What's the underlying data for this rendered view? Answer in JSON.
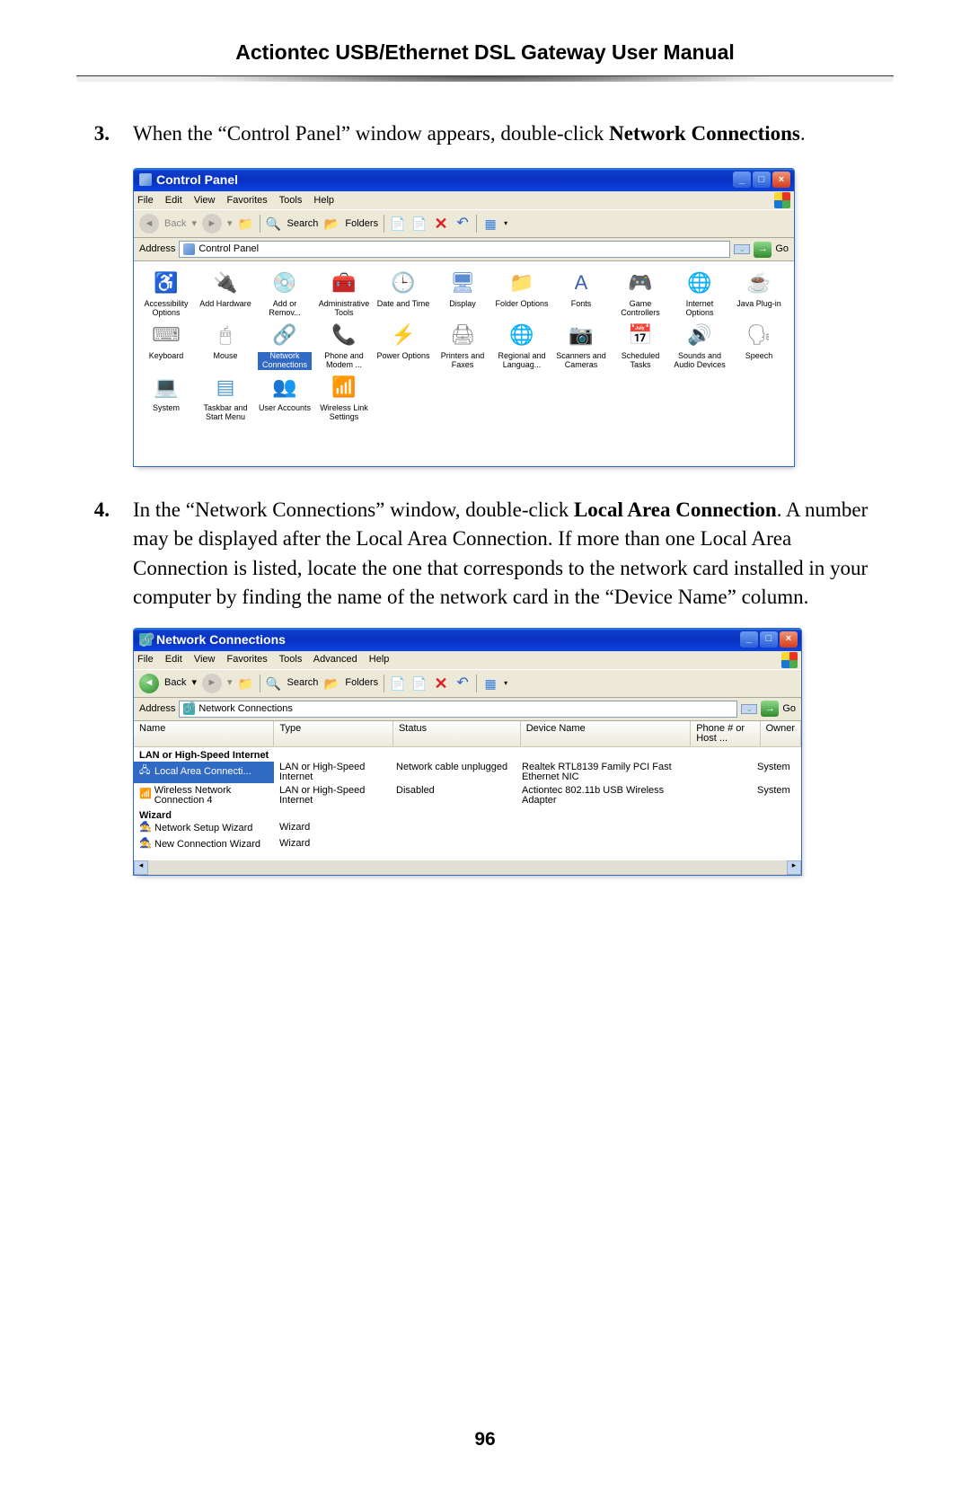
{
  "header": {
    "title": "Actiontec USB/Ethernet DSL Gateway User Manual"
  },
  "page_number": "96",
  "steps": [
    {
      "num": "3.",
      "pre": "When the “Control Panel” window appears, double-click",
      "bold": "Network Connections",
      "post": "."
    },
    {
      "num": "4.",
      "pre": "In the “Network Connections” window, double-click",
      "bold": "Local Area Connection",
      "post": ". A number may be displayed after the Local Area Connection. If more than one Local Area Connection is listed, locate the one that corresponds to the network card installed in your computer by finding the name of the network card in the “Device Name” column."
    }
  ],
  "cp": {
    "title": "Control Panel",
    "menu": [
      "File",
      "Edit",
      "View",
      "Favorites",
      "Tools",
      "Help"
    ],
    "back_label": "Back",
    "search_label": "Search",
    "folders_label": "Folders",
    "address_label": "Address",
    "address_value": "Control Panel",
    "go_label": "Go",
    "items": [
      {
        "glyph": "♿",
        "color": "#3a9a3a",
        "label": "Accessibility Options"
      },
      {
        "glyph": "🔌",
        "color": "#777",
        "label": "Add Hardware"
      },
      {
        "glyph": "💿",
        "color": "#5b8bd0",
        "label": "Add or Remov..."
      },
      {
        "glyph": "🧰",
        "color": "#b96a36",
        "label": "Administrative Tools"
      },
      {
        "glyph": "🕒",
        "color": "#5b8bd0",
        "label": "Date and Time"
      },
      {
        "glyph": "🖥",
        "color": "#5b8bd0",
        "label": "Display"
      },
      {
        "glyph": "📁",
        "color": "#e8c252",
        "label": "Folder Options"
      },
      {
        "glyph": "A",
        "color": "#3a5fb0",
        "label": "Fonts"
      },
      {
        "glyph": "🎮",
        "color": "#4a95c8",
        "label": "Game Controllers"
      },
      {
        "glyph": "🌐",
        "color": "#5b8bd0",
        "label": "Internet Options"
      },
      {
        "glyph": "☕",
        "color": "#b0302a",
        "label": "Java Plug-in"
      },
      {
        "glyph": "⌨",
        "color": "#888",
        "label": "Keyboard"
      },
      {
        "glyph": "🖱",
        "color": "#888",
        "label": "Mouse"
      },
      {
        "glyph": "🔗",
        "color": "#2a62c5",
        "label": "Network Connections",
        "selected": true
      },
      {
        "glyph": "📞",
        "color": "#e8c252",
        "label": "Phone and Modem ..."
      },
      {
        "glyph": "⚡",
        "color": "#5b8bd0",
        "label": "Power Options"
      },
      {
        "glyph": "🖨",
        "color": "#888",
        "label": "Printers and Faxes"
      },
      {
        "glyph": "🌐",
        "color": "#5b8bd0",
        "label": "Regional and Languag..."
      },
      {
        "glyph": "📷",
        "color": "#888",
        "label": "Scanners and Cameras"
      },
      {
        "glyph": "📅",
        "color": "#e8c252",
        "label": "Scheduled Tasks"
      },
      {
        "glyph": "🔊",
        "color": "#888",
        "label": "Sounds and Audio Devices"
      },
      {
        "glyph": "🗣",
        "color": "#888",
        "label": "Speech"
      },
      {
        "glyph": "💻",
        "color": "#5b8bd0",
        "label": "System"
      },
      {
        "glyph": "▤",
        "color": "#4a95c8",
        "label": "Taskbar and Start Menu"
      },
      {
        "glyph": "👥",
        "color": "#d08030",
        "label": "User Accounts"
      },
      {
        "glyph": "📶",
        "color": "#5b8bd0",
        "label": "Wireless Link Settings"
      }
    ]
  },
  "nc": {
    "title": "Network Connections",
    "menu": [
      "File",
      "Edit",
      "View",
      "Favorites",
      "Tools",
      "Advanced",
      "Help"
    ],
    "back_label": "Back",
    "search_label": "Search",
    "folders_label": "Folders",
    "address_label": "Address",
    "address_value": "Network Connections",
    "go_label": "Go",
    "cols": [
      "Name",
      "Type",
      "Status",
      "Device Name",
      "Phone # or Host ...",
      "Owner"
    ],
    "group1": "LAN or High-Speed Internet",
    "rows1": [
      {
        "icon": "🖧",
        "name": "Local Area Connecti...",
        "type": "LAN or High-Speed Internet",
        "status": "Network cable unplugged",
        "device": "Realtek RTL8139 Family PCI Fast Ethernet NIC",
        "phone": "",
        "owner": "System",
        "selected": true
      },
      {
        "icon": "📶",
        "name": "Wireless Network Connection 4",
        "type": "LAN or High-Speed Internet",
        "status": "Disabled",
        "device": "Actiontec 802.11b USB Wireless Adapter",
        "phone": "",
        "owner": "System"
      }
    ],
    "group2": "Wizard",
    "rows2": [
      {
        "icon": "🧙",
        "name": "Network Setup Wizard",
        "type": "Wizard",
        "status": "",
        "device": "",
        "phone": "",
        "owner": ""
      },
      {
        "icon": "🧙",
        "name": "New Connection Wizard",
        "type": "Wizard",
        "status": "",
        "device": "",
        "phone": "",
        "owner": ""
      }
    ]
  }
}
